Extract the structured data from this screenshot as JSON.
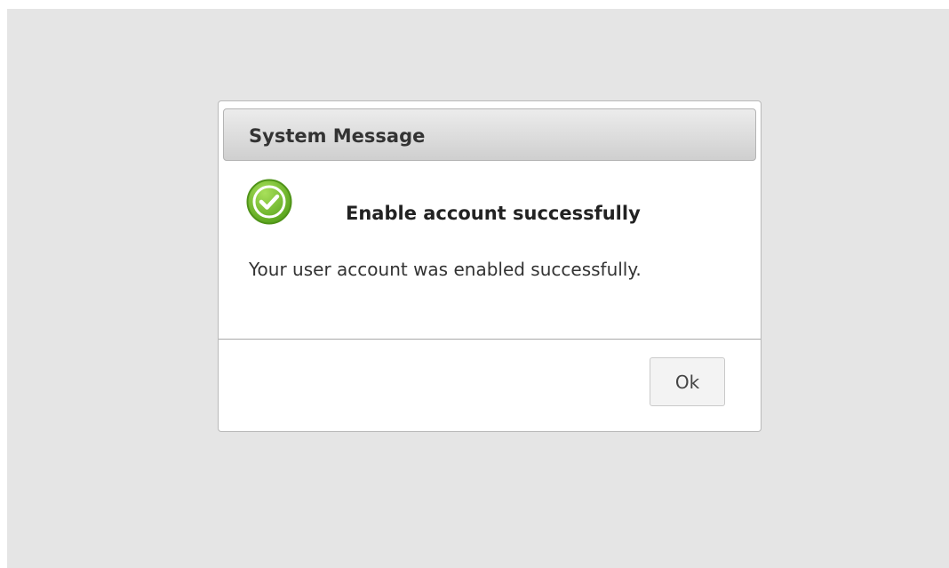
{
  "dialog": {
    "title": "System Message",
    "icon": "checkmark-success-icon",
    "headline": "Enable account successfully",
    "message": "Your user account was enabled successfully.",
    "ok_label": "Ok"
  },
  "colors": {
    "backdrop": "#e5e5e5",
    "success_green": "#7cc62f",
    "title_bar_top": "#ececec",
    "title_bar_bottom": "#cfcfcf"
  }
}
